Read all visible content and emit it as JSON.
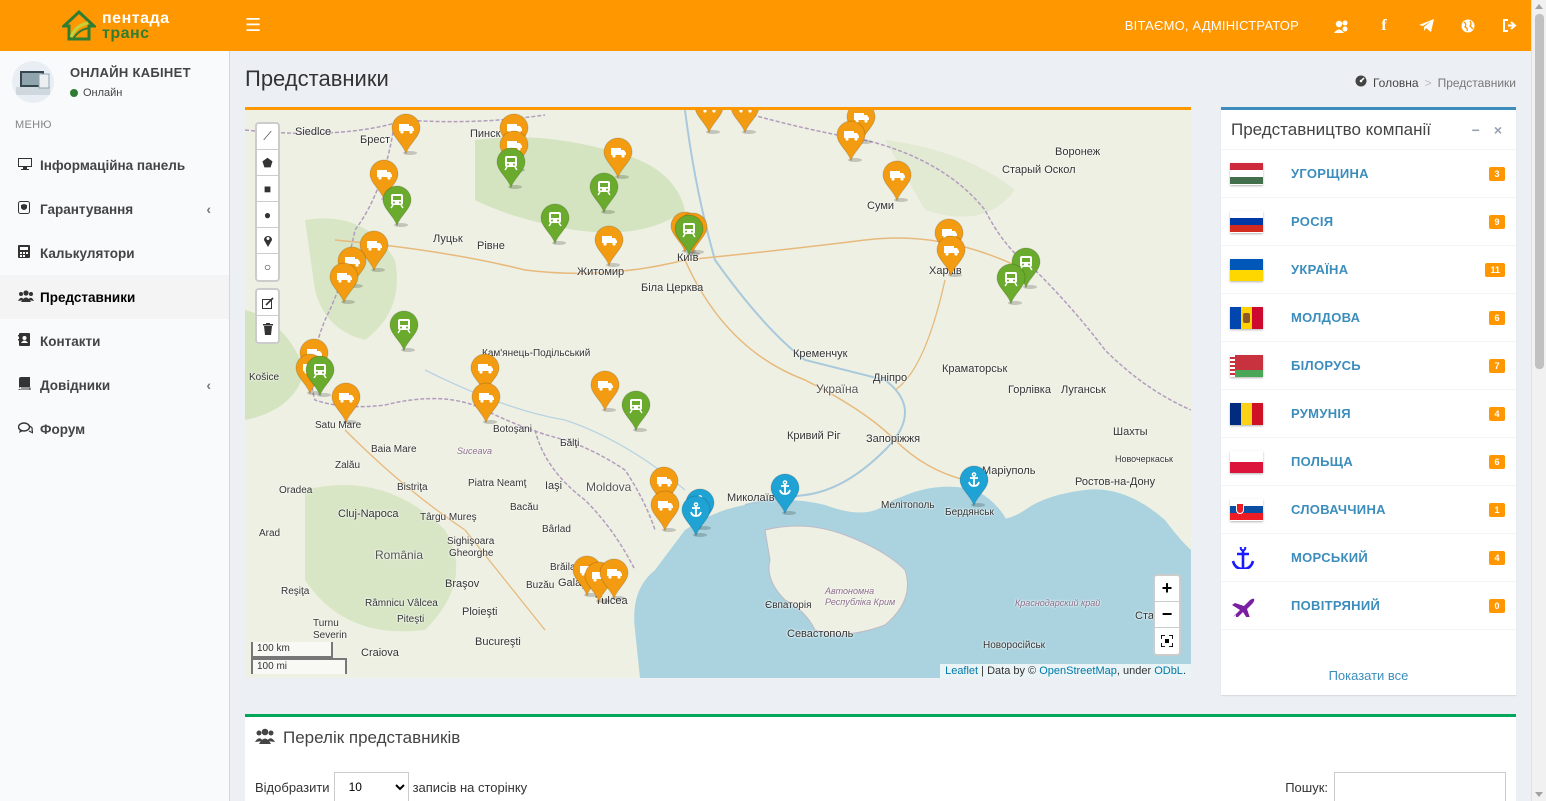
{
  "brand": {
    "line1": "пентада",
    "line2": "транс"
  },
  "header": {
    "welcome": "ВІТАЄМО, АДМІНІСТРАТОР",
    "icons": [
      "users-icon",
      "facebook-icon",
      "telegram-icon",
      "globe-icon",
      "sign-out-icon"
    ]
  },
  "user": {
    "name": "ОНЛАЙН КАБІНЕТ",
    "status": "Онлайн"
  },
  "menu": {
    "header": "МЕНЮ",
    "items": [
      {
        "label": "Інформаційна панель",
        "icon": "desktop-icon"
      },
      {
        "label": "Гарантування",
        "icon": "shield-icon"
      },
      {
        "label": "Калькулятори",
        "icon": "calculator-icon"
      },
      {
        "label": "Представники",
        "icon": "users-icon"
      },
      {
        "label": "Контакти",
        "icon": "address-book-icon"
      },
      {
        "label": "Довідники",
        "icon": "book-icon"
      },
      {
        "label": "Форум",
        "icon": "comments-icon"
      }
    ]
  },
  "page": {
    "title": "Представники"
  },
  "breadcrumb": {
    "home": "Головна",
    "current": "Представники"
  },
  "map": {
    "scale_km": "100 km",
    "scale_mi": "100 mi",
    "attribution_leaflet": "Leaflet",
    "attribution_mid": " | Data by © ",
    "attribution_osm": "OpenStreetMap",
    "attribution_under": ", under ",
    "attribution_odbl": "ODbL",
    "attribution_end": ".",
    "zoom_in": "+",
    "zoom_out": "−",
    "labels": [
      "Брест",
      "Пинск",
      "Siedlce",
      "Луцьк",
      "Рівне",
      "Житомир",
      "Київ",
      "Біла Церква",
      "Суми",
      "Воронеж",
      "Старый Оскол",
      "Харків",
      "Кременчук",
      "Україна",
      "Дніпро",
      "Краматорськ",
      "Горлівка",
      "Луганськ",
      "Кривий Ріг",
      "Запоріжжя",
      "Маріуполь",
      "Новочеркаськ",
      "Ростов-на-Дону",
      "Шахты",
      "Бердянськ",
      "Мелітополь",
      "Миколаїв",
      "Кам'янець-Подільський",
      "Бălţi",
      "Botoşani",
      "Suceava",
      "Iaşi",
      "Moldova",
      "Bacău",
      "Bârlad",
      "Košice",
      "Satu Mare",
      "Baia Mare",
      "Zalău",
      "Bistriţa",
      "Piatra Neamţ",
      "Cluj-Napoca",
      "Târgu Mureş",
      "Oradea",
      "Arad",
      "Sighişoara",
      "Gheorghe",
      "Braşov",
      "Buzău",
      "Brăila",
      "Galaţi",
      "Tulcea",
      "România",
      "Reşiţa",
      "Râmnicu Vâlcea",
      "Piteşti",
      "Ploieşti",
      "Bucureşti",
      "Craiova",
      "Severin",
      "Turnu",
      "Євпаторія",
      "Севастополь",
      "Автономна Республіка Крим",
      "Краснодарский край",
      "Новоросійськ",
      "Ста"
    ]
  },
  "countries_box": {
    "title": "Представництво компанії",
    "items": [
      {
        "name": "УГОРЩИНА",
        "count": "3",
        "flag": [
          "#cd2a3e",
          "#ffffff",
          "#436f4d"
        ]
      },
      {
        "name": "РОСІЯ",
        "count": "9",
        "flag": [
          "#ffffff",
          "#0039a6",
          "#d52b1e"
        ]
      },
      {
        "name": "УКРАЇНА",
        "count": "11",
        "flag": [
          "#0057b7",
          "#ffd700"
        ]
      },
      {
        "name": "МОЛДОВА",
        "count": "6",
        "flag": [
          "#0046ae",
          "#ffd200",
          "#cc092f"
        ]
      },
      {
        "name": "БІЛОРУСЬ",
        "count": "7",
        "flag": [
          "#c8313e",
          "#4aa657"
        ]
      },
      {
        "name": "РУМУНІЯ",
        "count": "4",
        "flag": [
          "#002b7f",
          "#fcd116",
          "#ce1126"
        ]
      },
      {
        "name": "ПОЛЬЩА",
        "count": "6",
        "flag": [
          "#ffffff",
          "#dc143c"
        ]
      },
      {
        "name": "СЛОВАЧЧИНА",
        "count": "1",
        "flag": [
          "#ffffff",
          "#0b4ea2",
          "#ee1c25"
        ]
      },
      {
        "name": "МОРСЬКИЙ",
        "count": "4",
        "icon": "anchor-icon"
      },
      {
        "name": "ПОВІТРЯНИЙ",
        "count": "0",
        "icon": "plane-icon"
      }
    ],
    "show_all": "Показати все"
  },
  "list_box": {
    "title": "Перелік представників",
    "show_label": "Відобразити",
    "per_page_value": "10",
    "per_page_suffix": "записів на сторінку",
    "search_label": "Пошук:"
  },
  "colors": {
    "accent": "#ff9800",
    "primary": "#3c8dbc",
    "success": "#00a65a",
    "truck_pin": "#f39c12",
    "train_pin": "#6aaa2c",
    "port_pin": "#1fa3d4"
  }
}
